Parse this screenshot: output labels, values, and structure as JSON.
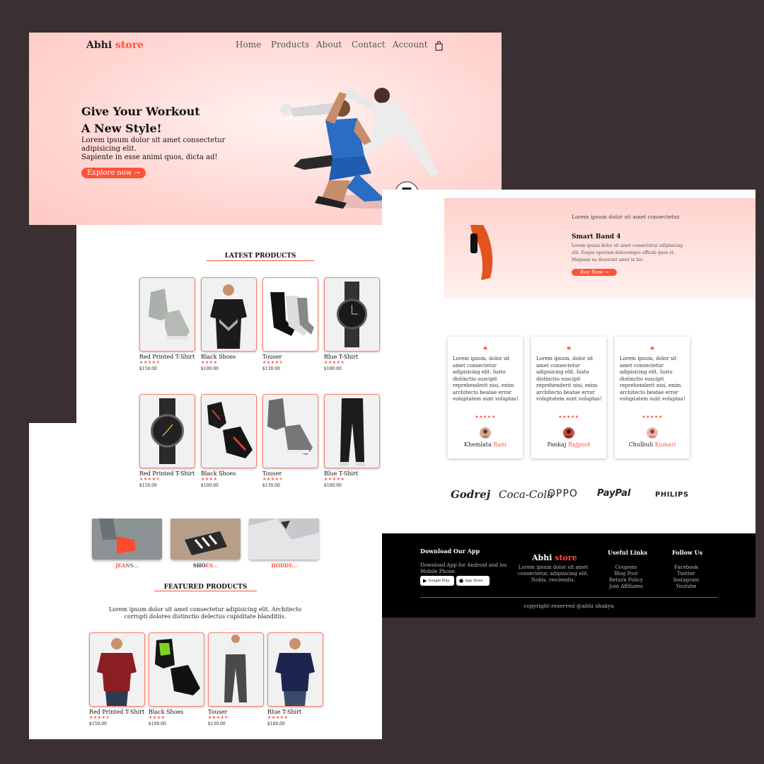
{
  "header": {
    "logo_main": "Abhi",
    "logo_accent": "store",
    "nav": [
      "Home",
      "Products",
      "About",
      "Contact",
      "Account"
    ]
  },
  "hero": {
    "title_line1": "Give Your Workout",
    "title_line2": "A New Style!",
    "text_line1": "Lorem ipsum dolor sit amet consectetur adipisicing elit.",
    "text_line2": "Sapiente in esse animi quos, dicta ad!",
    "button": "Explore now →"
  },
  "latest": {
    "title": "LATEST PRODUCTS",
    "rows": [
      [
        {
          "name": "Red Printed T-Shirt",
          "stars": "★★★★⯪",
          "price": "$150.00"
        },
        {
          "name": "Black Shoes",
          "stars": "★★★★",
          "price": "$100.00"
        },
        {
          "name": "Touser",
          "stars": "★★★★⯪",
          "price": "$130.00"
        },
        {
          "name": "Blue T-Shirt",
          "stars": "★★★★★",
          "price": "$180.00"
        }
      ],
      [
        {
          "name": "Red Printed T-Shirt",
          "stars": "★★★★⯪",
          "price": "$150.00"
        },
        {
          "name": "Black Shoes",
          "stars": "★★★★",
          "price": "$100.00"
        },
        {
          "name": "Touser",
          "stars": "★★★★⯪",
          "price": "$130.00"
        },
        {
          "name": "Blue T-Shirt",
          "stars": "★★★★★",
          "price": "$180.00"
        }
      ]
    ]
  },
  "categories": [
    {
      "prefix": "JEA",
      "accent": "NS..."
    },
    {
      "prefix": "SHO",
      "accent": "ES..."
    },
    {
      "prefix": "HOD",
      "accent": "DY..."
    }
  ],
  "featured": {
    "title": "FEATURED PRODUCTS",
    "text_line1": "Lorem ipsum dolor sit amet consectetur adipisicing elit. Architecto",
    "text_line2": "corrupti dolores distinctio delectus cupiditate blanditiis.",
    "items": [
      {
        "name": "Red Printed T-Shirt",
        "stars": "★★★★⯪",
        "price": "$150.00"
      },
      {
        "name": "Black Shoes",
        "stars": "★★★★",
        "price": "$100.00"
      },
      {
        "name": "Touser",
        "stars": "★★★★⯪",
        "price": "$130.00"
      },
      {
        "name": "Blue T-Shirt",
        "stars": "★★★★★",
        "price": "$180.00"
      }
    ]
  },
  "offer": {
    "kicker": "Lorem ipsum dolor sit amet consectetur.",
    "title": "Smart Band 4",
    "text": "Lorem ipsum dolor sit amet consectetur adipisicing elit. Eaque aperiam doloremque officiis quos et. Magnam ea deserunt amet in hic.",
    "button": "Buy Now →"
  },
  "testimonials": [
    {
      "text": "Lorem ipsum, dolor sit amet consectetur adipisicing elit. Iusto distinctio suscipit reprehenderit nisi, enim architecto beatae error voluptatem sunt voluptas!",
      "stars": "★★★★★",
      "first": "Khemlata",
      "last": "Rani"
    },
    {
      "text": "Lorem ipsum, dolor sit amet consectetur adipisicing elit. Iusto distinctio suscipit reprehenderit nisi, enim architecto beatae error voluptatem sunt voluptas!",
      "stars": "★★★★★",
      "first": "Pankaj",
      "last": "Rajpoot"
    },
    {
      "text": "Lorem ipsum, dolor sit amet consectetur adipisicing elit. Iusto distinctio suscipit reprehenderit nisi, enim architecto beatae error voluptatem sunt voluptas!",
      "stars": "★★★★★",
      "first": "Chulbuli",
      "last": "Kumari"
    }
  ],
  "brands": [
    "Godrej",
    "Coca-Cola",
    "OPPO",
    "PayPal",
    "PHILIPS"
  ],
  "footer": {
    "app_title": "Download Our App",
    "app_text": "Download App for Android and ios Mobile Phone.",
    "google_play": "Google Play",
    "app_store": "App Store",
    "logo_main": "Abhi",
    "logo_accent": "store",
    "about": "Lorem ipsum dolor sit amet consectetur, adipisicing elit. Nobis, reiciendis.",
    "links_title": "Useful Links",
    "links": [
      "Coupons",
      "Blog Post",
      "Return Policy",
      "Join Affiliates"
    ],
    "follow_title": "Follow Us",
    "follow": [
      "Facebook",
      "Twitter",
      "Instagram",
      "Youtube"
    ],
    "copyright": "copyright-reserved @abhi shakya"
  },
  "colors": {
    "accent": "#ff523b",
    "hero_bg": "#ffd6d2",
    "footer_bg": "#000000",
    "page_bg": "#3a3033"
  }
}
